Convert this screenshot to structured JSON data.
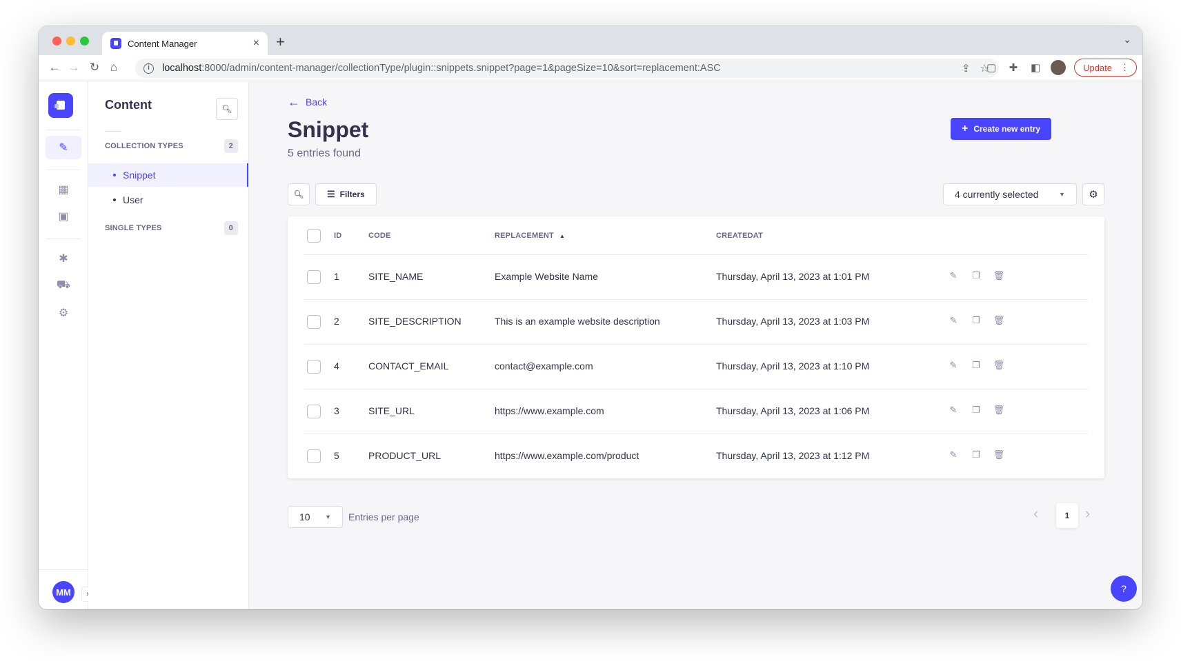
{
  "browser": {
    "tab_title": "Content Manager",
    "tab_close": "×",
    "new_tab": "+",
    "url_host": "localhost",
    "url_rest": ":8000/admin/content-manager/collectionType/plugin::snippets.snippet?page=1&pageSize=10&sort=replacement:ASC",
    "update_label": "Update"
  },
  "colors": {
    "primary": "#4945ff",
    "text": "#32324d",
    "muted": "#666687",
    "danger": "#d93025"
  },
  "mainnav": {
    "items": [
      "content-manager-icon",
      "content-type-builder-icon",
      "media-library-icon",
      "plugins-icon",
      "marketplace-icon",
      "settings-icon"
    ],
    "avatar_initials": "MM"
  },
  "subnav": {
    "title": "Content",
    "collection_types": {
      "label": "COLLECTION TYPES",
      "count": "2",
      "items": [
        "Snippet",
        "User"
      ]
    },
    "single_types": {
      "label": "SINGLE TYPES",
      "count": "0"
    }
  },
  "header": {
    "back_label": "Back",
    "title": "Snippet",
    "subtitle": "5 entries found",
    "create_label": "Create new entry"
  },
  "toolbar": {
    "filters_label": "Filters",
    "columns_selected": "4 currently selected"
  },
  "table": {
    "headers": {
      "id": "ID",
      "code": "CODE",
      "replacement": "REPLACEMENT",
      "createdat": "CREATEDAT"
    },
    "sort_column": "replacement",
    "sort_direction": "ASC",
    "rows": [
      {
        "id": "1",
        "code": "SITE_NAME",
        "replacement": "Example Website Name",
        "createdat": "Thursday, April 13, 2023 at 1:01 PM"
      },
      {
        "id": "2",
        "code": "SITE_DESCRIPTION",
        "replacement": "This is an example website description",
        "createdat": "Thursday, April 13, 2023 at 1:03 PM"
      },
      {
        "id": "4",
        "code": "CONTACT_EMAIL",
        "replacement": "contact@example.com",
        "createdat": "Thursday, April 13, 2023 at 1:10 PM"
      },
      {
        "id": "3",
        "code": "SITE_URL",
        "replacement": "https://www.example.com",
        "createdat": "Thursday, April 13, 2023 at 1:06 PM"
      },
      {
        "id": "5",
        "code": "PRODUCT_URL",
        "replacement": "https://www.example.com/product",
        "createdat": "Thursday, April 13, 2023 at 1:12 PM"
      }
    ]
  },
  "pagination": {
    "page_size": "10",
    "entries_label": "Entries per page",
    "current_page": "1"
  },
  "help_label": "?"
}
